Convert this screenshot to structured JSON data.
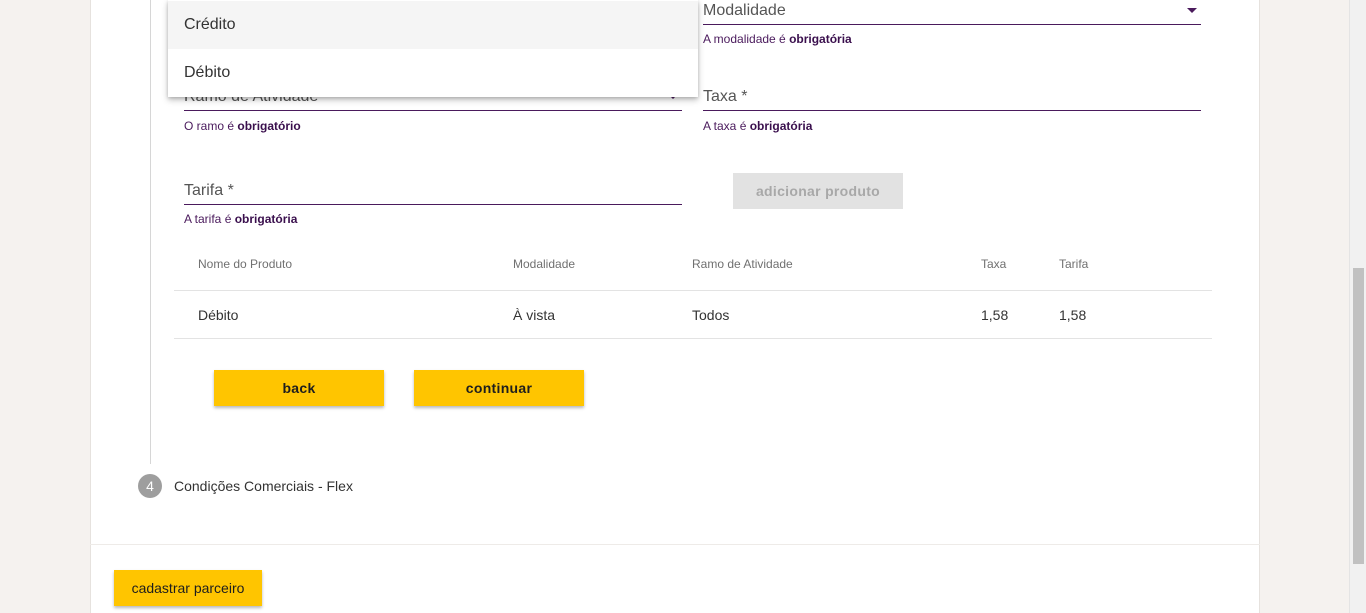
{
  "form": {
    "modalidade": {
      "label": "Modalidade",
      "hint_prefix": "A modalidade é ",
      "hint_strong": "obrigatória"
    },
    "ramo": {
      "label": "Ramo de Atividade",
      "hint_prefix": "O ramo é ",
      "hint_strong": "obrigatório"
    },
    "taxa": {
      "label": "Taxa *",
      "hint_prefix": "A taxa é ",
      "hint_strong": "obrigatória"
    },
    "tarifa": {
      "label": "Tarifa *",
      "hint_prefix": "A tarifa é ",
      "hint_strong": "obrigatória"
    },
    "add_product_label": "adicionar produto"
  },
  "dropdown": {
    "options": [
      "Crédito",
      "Débito"
    ],
    "highlighted_index": 0
  },
  "table": {
    "headers": [
      "Nome do Produto",
      "Modalidade",
      "Ramo de Atividade",
      "Taxa",
      "Tarifa"
    ],
    "rows": [
      [
        "Débito",
        "À vista",
        "Todos",
        "1,58",
        "1,58"
      ]
    ]
  },
  "actions": {
    "back_label": "back",
    "continue_label": "continuar"
  },
  "steps": {
    "step4": {
      "number": "4",
      "title": "Condições Comerciais - Flex"
    }
  },
  "footer": {
    "register_label": "cadastrar parceiro"
  },
  "colors": {
    "accent_yellow": "#ffc500",
    "brand_purple": "#4a1a5c",
    "disabled_gray": "#e2e2e2"
  }
}
